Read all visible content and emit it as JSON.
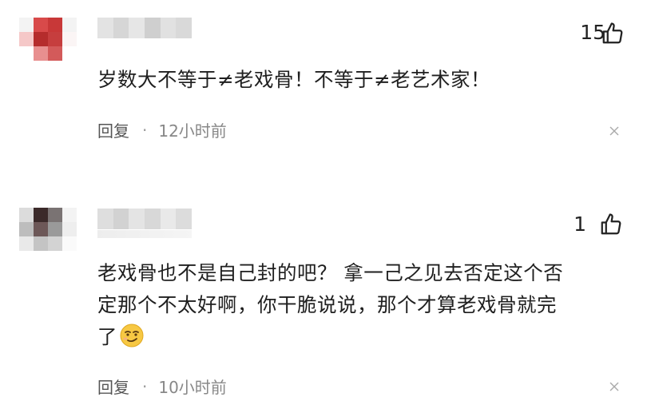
{
  "comments": [
    {
      "like_count": "15",
      "text": "岁数大不等于≠老戏骨！不等于≠老艺术家！",
      "reply_label": "回复",
      "separator": "·",
      "time": "12小时前"
    },
    {
      "like_count": "1",
      "text_line1": "老戏骨也不是自己封的吧？ 拿一己之见去否定这个否",
      "text_line2": "定那个不太好啊，你干脆说说，那个才算老戏骨就完",
      "text_line3": "了",
      "reply_label": "回复",
      "separator": "·",
      "time": "10小时前"
    }
  ],
  "icons": {
    "like": "thumbs-up-outline-icon",
    "close": "close-x-icon",
    "emoji": "smirk-face-emoji"
  },
  "colors": {
    "text": "#1f1f1f",
    "meta": "#888888",
    "icon": "#222222"
  }
}
